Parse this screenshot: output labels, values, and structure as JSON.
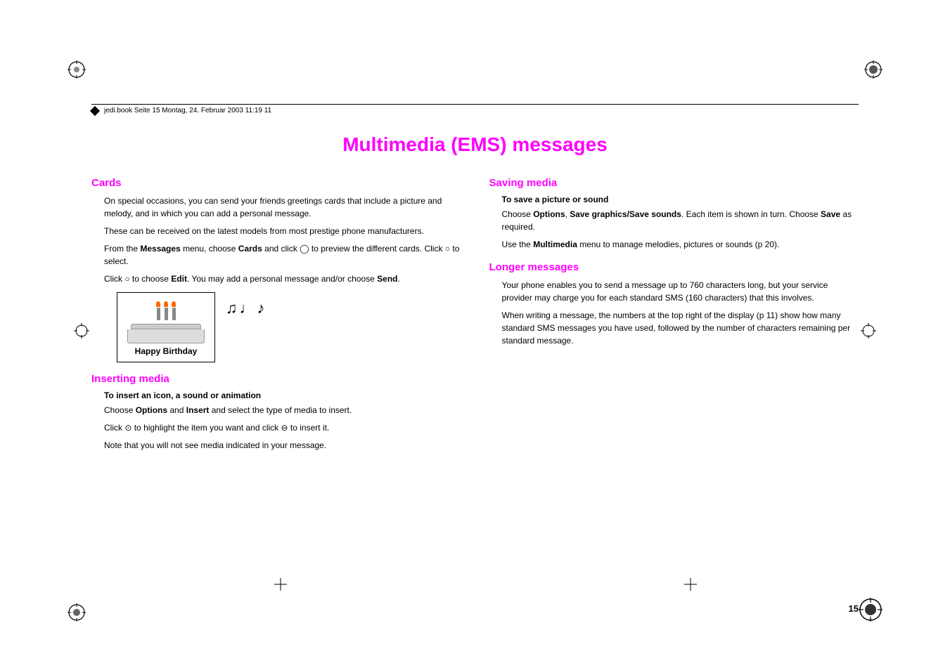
{
  "page": {
    "number": "15",
    "file_info": "jedi.book  Seite 15  Montag, 24. Februar 2003  11:19 11"
  },
  "title": "Multimedia (EMS) messages",
  "left_col": {
    "section1": {
      "heading": "Cards",
      "paragraphs": [
        "On special occasions, you can send your friends greetings cards that include a picture and melody, and in which you can add a personal message.",
        "These can be received on the latest models from most prestige phone manufacturers."
      ],
      "para3": "From the ",
      "para3_bold1": "Messages",
      "para3_mid": " menu, choose ",
      "para3_bold2": "Cards",
      "para3_end": " and click ⊙ to preview the different cards. Click ⊖ to select.",
      "para4_start": "Click ⊖ to choose ",
      "para4_bold": "Edit",
      "para4_mid": ". You may add a personal message and/or choose ",
      "para4_bold2": "Send",
      "para4_end": ".",
      "birthday_card_label": "Happy Birthday"
    },
    "section2": {
      "heading": "Inserting media",
      "subtitle": "To insert an icon, a sound or animation",
      "para1_start": "Choose ",
      "para1_bold1": "Options",
      "para1_mid": " and ",
      "para1_bold2": "Insert",
      "para1_end": " and select the type of media to insert.",
      "para2_start": "Click ⊙ to highlight the item you want and click ⊖ to insert it.",
      "para3": "Note that you will not see media indicated in your message."
    }
  },
  "right_col": {
    "section1": {
      "heading": "Saving media",
      "subtitle": "To save a picture or sound",
      "para1_start": "Choose ",
      "para1_bold1": "Options",
      "para1_sep": ", ",
      "para1_bold2": "Save graphics/Save sounds",
      "para1_end": ". Each item is shown in turn. Choose ",
      "para1_bold3": "Save",
      "para1_end2": " as required.",
      "para2_start": "Use the ",
      "para2_bold": "Multimedia",
      "para2_end": " menu to manage melodies, pictures or sounds (p 20)."
    },
    "section2": {
      "heading": "Longer messages",
      "para1": "Your phone enables you to send a message up to 760 characters long, but your service provider may charge you for each standard SMS (160 characters) that this involves.",
      "para2": "When writing a message, the numbers at the top right of the display (p 11) show how many standard SMS messages you have used, followed by the number of characters remaining per standard message."
    }
  }
}
